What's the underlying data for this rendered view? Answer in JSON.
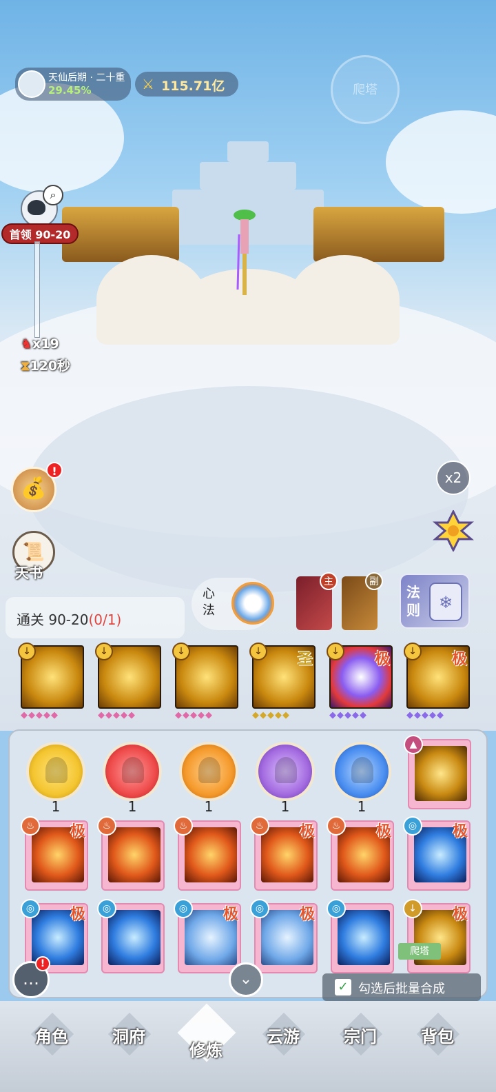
{
  "hud": {
    "realm_name": "天仙后期 · 二十重",
    "realm_progress": "29.45%",
    "power_value": "115.71亿",
    "tower_button": "爬塔"
  },
  "boss": {
    "label": "首领 90-20",
    "multiplier": "x19",
    "timer": "120秒"
  },
  "side": {
    "book_label": "天书",
    "bag_badge": "!",
    "speed_label": "x2"
  },
  "stage": {
    "clear_label": "通关 90-20",
    "clear_progress": "(0/1)"
  },
  "equip": {
    "xinfa_label": "心法",
    "main_tag": "主",
    "sub_tag": "副",
    "rule_label": "法则"
  },
  "skills": [
    {
      "grade": ""
    },
    {
      "grade": ""
    },
    {
      "grade": ""
    },
    {
      "grade": "圣",
      "grade_color": "#c9a020"
    },
    {
      "grade": "极",
      "grade_color": "#e4572e"
    },
    {
      "grade": "极",
      "grade_color": "#e4572e"
    }
  ],
  "orbs": [
    {
      "count": "1",
      "color": "#f4c530"
    },
    {
      "count": "1",
      "color": "#ef4b4b"
    },
    {
      "count": "1",
      "color": "#f59a2c"
    },
    {
      "count": "1",
      "color": "#a46be0"
    },
    {
      "count": "1",
      "color": "#4a8ef0"
    }
  ],
  "cards": {
    "row2": [
      {
        "grade": "极"
      },
      {
        "grade": ""
      },
      {
        "grade": ""
      },
      {
        "grade": "极"
      },
      {
        "grade": "极"
      },
      {
        "grade": "极"
      }
    ],
    "row3": [
      {
        "grade": "极"
      },
      {
        "grade": ""
      },
      {
        "grade": "极"
      },
      {
        "grade": "极"
      },
      {
        "grade": ""
      },
      {
        "grade": "极"
      }
    ]
  },
  "tower_tag": "爬塔",
  "merge_label": "勾选后批量合成",
  "nav": {
    "role": "角色",
    "cave": "洞府",
    "cultivate": "修炼",
    "travel": "云游",
    "sect": "宗门",
    "bag": "背包"
  }
}
